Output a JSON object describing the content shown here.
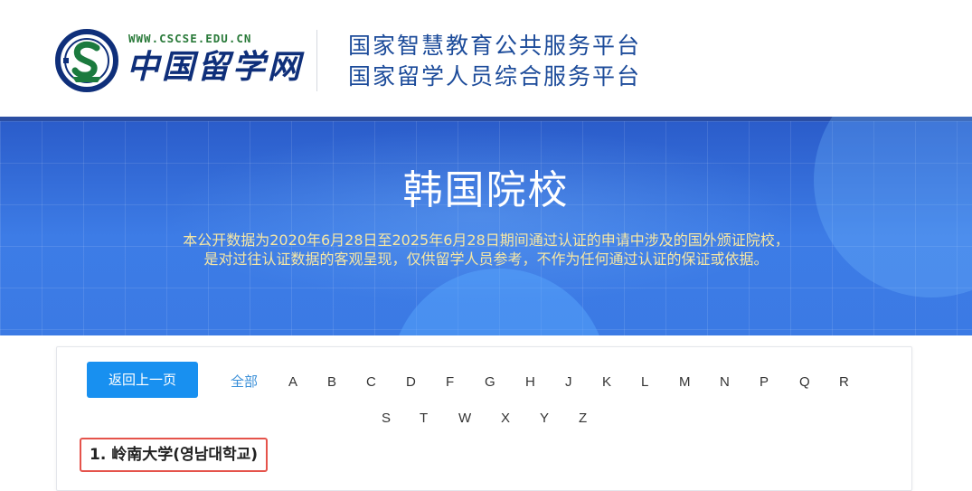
{
  "header": {
    "site_url": "WWW.CSCSE.EDU.CN",
    "site_name": "中国留学网",
    "platform_lines": [
      "国家智慧教育公共服务平台",
      "国家留学人员综合服务平台"
    ],
    "logo_icon": "cscse-logo-icon"
  },
  "banner": {
    "title": "韩国院校",
    "description_lines": [
      "本公开数据为2020年6月28日至2025年6月28日期间通过认证的申请中涉及的国外颁证院校，",
      "是对过往认证数据的客观呈现，仅供留学人员参考，不作为任何通过认证的保证或依据。"
    ]
  },
  "toolbar": {
    "back_label": "返回上一页"
  },
  "letter_filter": {
    "all_label": "全部",
    "row1": [
      "A",
      "B",
      "C",
      "D",
      "F",
      "G",
      "H",
      "J",
      "K",
      "L",
      "M",
      "N",
      "P",
      "Q",
      "R"
    ],
    "row2": [
      "S",
      "T",
      "W",
      "X",
      "Y",
      "Z"
    ]
  },
  "results": [
    {
      "index": "1.",
      "name": "岭南大学(영남대학교)"
    }
  ],
  "colors": {
    "brand_blue": "#1c4b9a",
    "button_blue": "#1890f0",
    "banner_blue": "#3d7ce6",
    "desc_yellow": "#f6e7a4",
    "highlight_red": "#e5534b",
    "active_letter": "#3a8fd8"
  }
}
